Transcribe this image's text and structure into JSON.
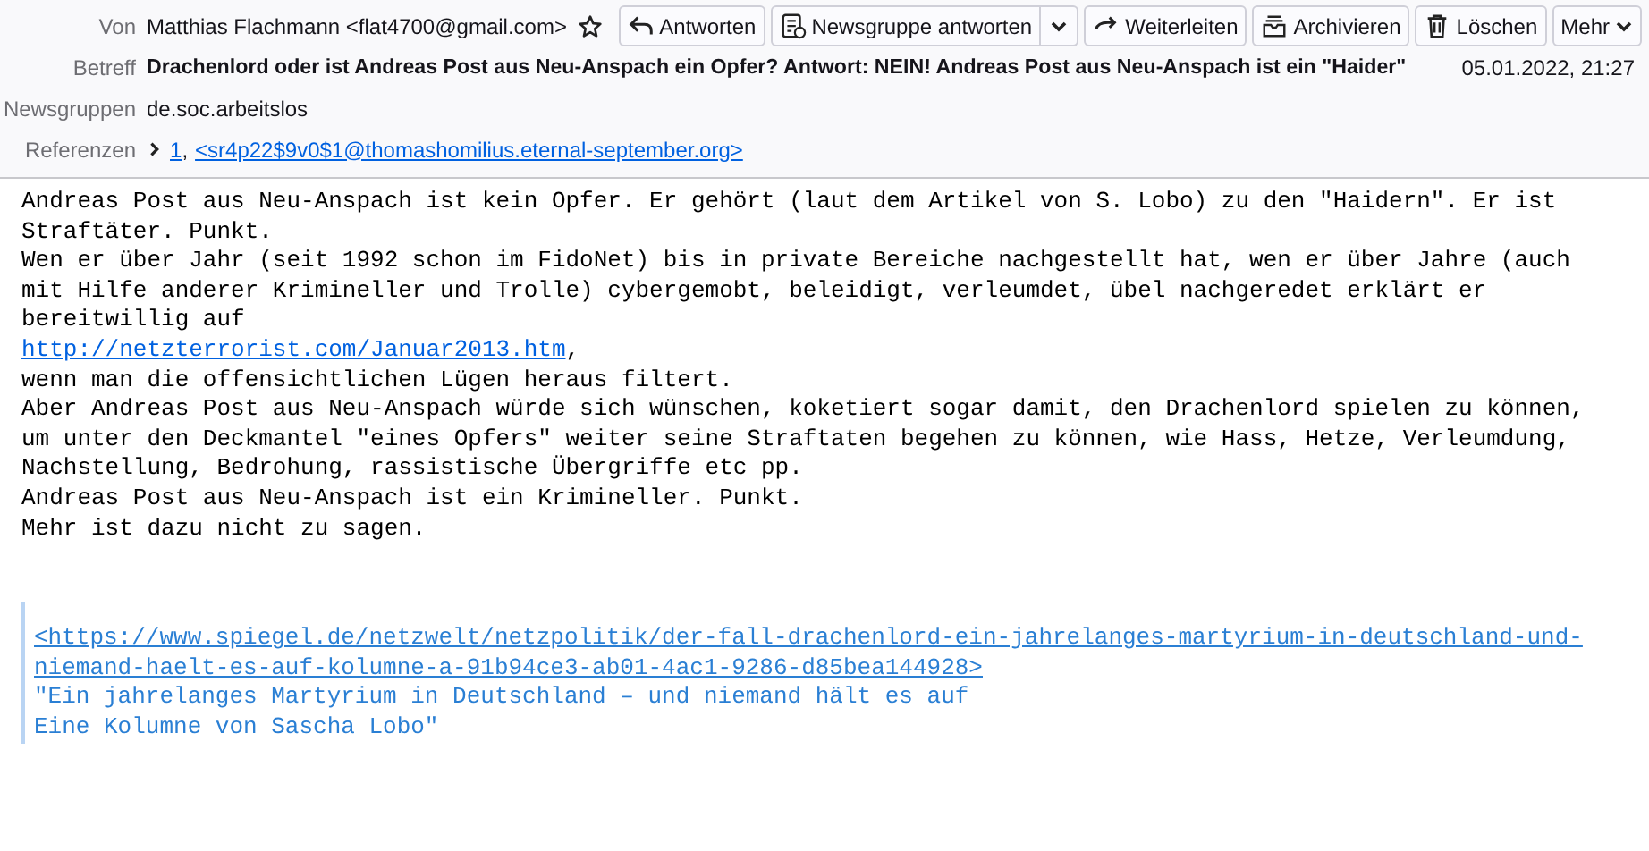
{
  "header": {
    "from": {
      "label": "Von",
      "value": "Matthias Flachmann <flat4700@gmail.com>",
      "starred": false
    },
    "buttons": [
      {
        "kind": "reply",
        "label": "Antworten"
      },
      {
        "kind": "reply-group",
        "label": "Newsgruppe antworten",
        "split": true
      },
      {
        "kind": "forward",
        "label": "Weiterleiten"
      },
      {
        "kind": "archive",
        "label": "Archivieren"
      },
      {
        "kind": "delete",
        "label": "Löschen"
      },
      {
        "kind": "more",
        "label": "Mehr"
      }
    ],
    "subject": {
      "label": "Betreff",
      "value": "Drachenlord oder ist Andreas Post aus Neu-Anspach ein Opfer? Antwort: NEIN! Andreas Post aus Neu-Anspach ist ein \"Haider\""
    },
    "date": "05.01.2022, 21:27",
    "newsgroups": {
      "label": "Newsgruppen",
      "value": "de.soc.arbeitslos"
    },
    "references": {
      "label": "Referenzen",
      "links": [
        "1",
        "<sr4p22$9v0$1@thomashomilius.eternal-september.org>"
      ],
      "separator": ","
    }
  },
  "body": {
    "lines": [
      {
        "kind": "text",
        "text": "Andreas Post aus Neu-Anspach ist kein Opfer. Er gehört (laut dem Artikel von S. Lobo) zu den \"Haidern\". Er ist"
      },
      {
        "kind": "text",
        "text": "Straftäter. Punkt."
      },
      {
        "kind": "text",
        "text": "Wen er über Jahr (seit 1992 schon im FidoNet) bis in private Bereiche nachgestellt hat, wen er über Jahre (auch"
      },
      {
        "kind": "text",
        "text": "mit Hilfe anderer Krimineller und Trolle) cybergemobt, beleidigt, verleumdet, übel nachgeredet erklärt er"
      },
      {
        "kind": "text",
        "text": "bereitwillig auf"
      },
      {
        "kind": "link",
        "text": "http://netzterrorist.com/Januar2013.htm",
        "after": ","
      },
      {
        "kind": "text",
        "text": "wenn man die offensichtlichen Lügen heraus filtert."
      },
      {
        "kind": "text",
        "text": "Aber Andreas Post aus Neu-Anspach würde sich wünschen, koketiert sogar damit, den Drachenlord spielen zu können,"
      },
      {
        "kind": "text",
        "text": "um unter den Deckmantel \"eines Opfers\" weiter seine Straftaten begehen zu können, wie Hass, Hetze, Verleumdung,"
      },
      {
        "kind": "text",
        "text": "Nachstellung, Bedrohung, rassistische Übergriffe etc pp."
      },
      {
        "kind": "text",
        "text": "Andreas Post aus Neu-Anspach ist ein Krimineller. Punkt."
      },
      {
        "kind": "text",
        "text": "Mehr ist dazu nicht zu sagen."
      }
    ],
    "quote": {
      "link_lines": [
        "<https://www.spiegel.de/netzwelt/netzpolitik/der-fall-drachenlord-ein-jahrelanges-martyrium-in-deutschland-und-",
        "niemand-haelt-es-auf-kolumne-a-91b94ce3-ab01-4ac1-9286-d85bea144928>"
      ],
      "lines": [
        "\"Ein jahrelanges Martyrium in Deutschland – und niemand hält es auf",
        "Eine Kolumne von Sascha Lobo\""
      ]
    }
  }
}
